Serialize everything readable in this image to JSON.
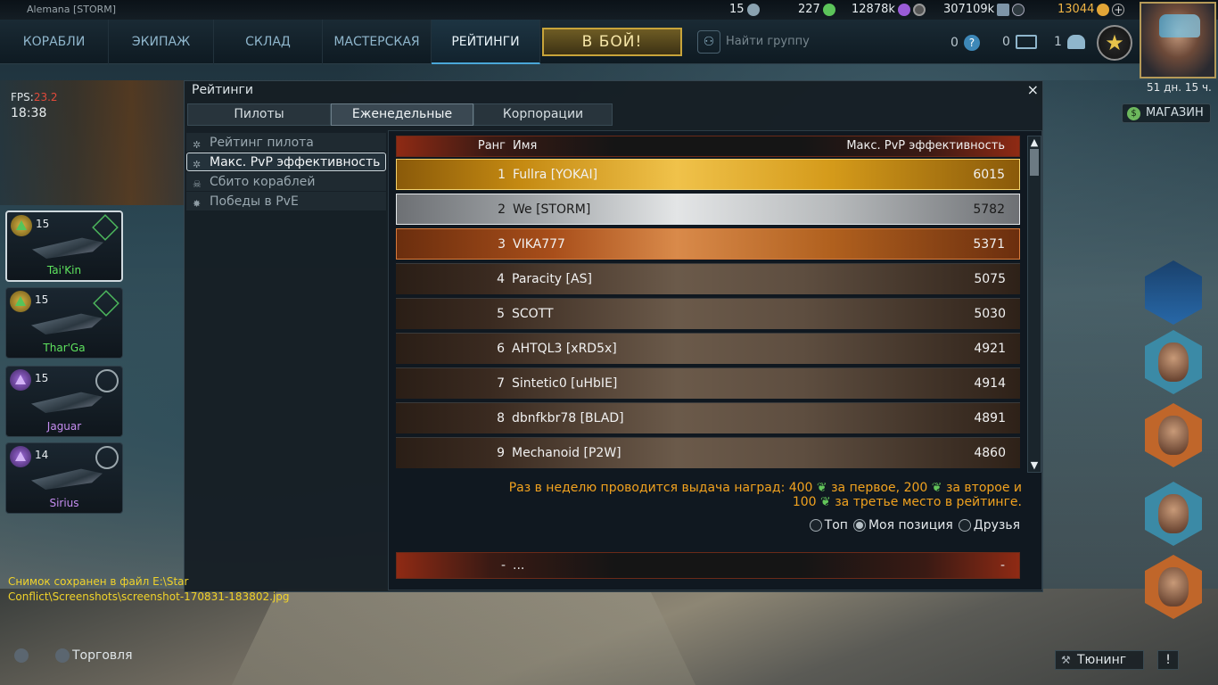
{
  "window": {
    "player_tag": "Alemana [STORM]"
  },
  "resources": {
    "players_online": "15",
    "green_currency": "227",
    "purple_currency": "12878k",
    "credits": "307109k",
    "gold": "13044"
  },
  "nav": {
    "items": [
      "КОРАБЛИ",
      "ЭКИПАЖ",
      "СКЛАД",
      "МАСТЕРСКАЯ",
      "РЕЙТИНГИ"
    ],
    "active": "РЕЙТИНГИ",
    "battle_label": "В БОЙ!",
    "find_group": "Найти группу",
    "help_count": "0",
    "mail_count": "0",
    "friends_count": "1"
  },
  "profile": {
    "timer": "51 дн. 15 ч.",
    "shop_label": "МАГАЗИН"
  },
  "hud": {
    "fps_label": "FPS:",
    "fps_value": "23.2",
    "clock": "18:38"
  },
  "ships": [
    {
      "name": "Tai'Kin",
      "level": "15",
      "name_color": "#5ee35e"
    },
    {
      "name": "Thar'Ga",
      "level": "15",
      "name_color": "#5ee35e"
    },
    {
      "name": "Jaguar",
      "level": "15",
      "name_color": "#c58df0"
    },
    {
      "name": "Sirius",
      "level": "14",
      "name_color": "#c58df0"
    }
  ],
  "panel": {
    "title": "Рейтинги",
    "close": "×",
    "tabs": [
      "Пилоты",
      "Еженедельные",
      "Корпорации"
    ],
    "active_tab": "Еженедельные",
    "categories": [
      "Рейтинг пилота",
      "Макс. PvP эффективность",
      "Сбито кораблей",
      "Победы в PvE"
    ],
    "active_category": "Макс. PvP эффективность",
    "columns": {
      "rank": "Ранг",
      "name": "Имя",
      "value": "Макс. PvP эффективность"
    },
    "rows": [
      {
        "rank": "1",
        "name": "Fullra [YOKAI]",
        "value": "6015"
      },
      {
        "rank": "2",
        "name": "We [STORM]",
        "value": "5782"
      },
      {
        "rank": "3",
        "name": "VIKA777",
        "value": "5371"
      },
      {
        "rank": "4",
        "name": "Paracity [AS]",
        "value": "5075"
      },
      {
        "rank": "5",
        "name": "SCOTT",
        "value": "5030"
      },
      {
        "rank": "6",
        "name": "AHTQL3 [xRD5x]",
        "value": "4921"
      },
      {
        "rank": "7",
        "name": "Sintetic0 [uHbIE]",
        "value": "4914"
      },
      {
        "rank": "8",
        "name": "dbnfkbr78 [BLAD]",
        "value": "4891"
      },
      {
        "rank": "9",
        "name": "Mechanoid [P2W]",
        "value": "4860"
      }
    ],
    "reward_line1_a": "Раз в неделю проводится выдача наград: 400",
    "reward_line1_b": "за первое, 200",
    "reward_line1_c": "за второе и",
    "reward_line2_a": "100",
    "reward_line2_b": "за третье место в рейтинге.",
    "filters": [
      "Топ",
      "Моя позиция",
      "Друзья"
    ],
    "active_filter": "Моя позиция",
    "my_row": {
      "rank": "-",
      "name": "...",
      "value": "-"
    }
  },
  "chat_log": "Снимок сохранен в файл E:\\Star Conflict\\Screenshots\\screenshot-170831-183802.jpg",
  "bottom": {
    "trade": "Торговля",
    "tuning": "Тюнинг",
    "alert": "!"
  }
}
